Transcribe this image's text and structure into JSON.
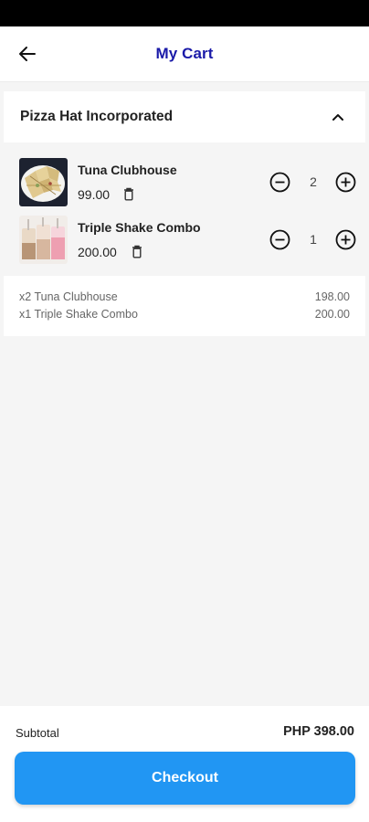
{
  "header": {
    "title": "My Cart",
    "back_icon": "arrow-left-icon"
  },
  "store": {
    "name": "Pizza Hat Incorporated",
    "collapse_icon": "chevron-up-icon"
  },
  "items": [
    {
      "name": "Tuna Clubhouse",
      "price": "99.00",
      "quantity": "2"
    },
    {
      "name": "Triple Shake Combo",
      "price": "200.00",
      "quantity": "1"
    }
  ],
  "summary": [
    {
      "label": "x2 Tuna Clubhouse",
      "amount": "198.00"
    },
    {
      "label": "x1 Triple Shake Combo",
      "amount": "200.00"
    }
  ],
  "footer": {
    "subtotal_label": "Subtotal",
    "subtotal_value": "PHP 398.00",
    "checkout_label": "Checkout"
  },
  "colors": {
    "title": "#1a1aa8",
    "checkout": "#2196f3",
    "status_bar": "#000000"
  }
}
